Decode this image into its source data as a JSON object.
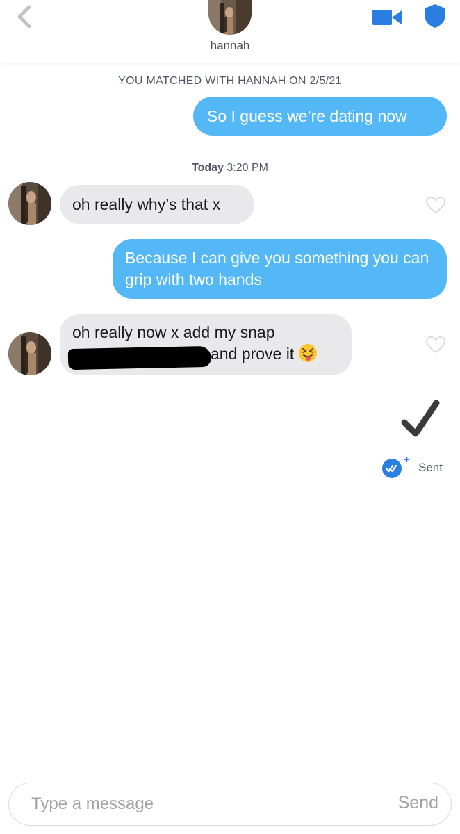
{
  "header": {
    "contact_name": "hannah"
  },
  "thread": {
    "match_banner": "YOU MATCHED WITH HANNAH ON 2/5/21",
    "timestamp_day": "Today",
    "timestamp_time": "3:20 PM",
    "messages": [
      {
        "direction": "outgoing",
        "text": "So I guess we’re dating now"
      },
      {
        "direction": "incoming",
        "text": "oh really why’s that x"
      },
      {
        "direction": "outgoing",
        "text": "Because I can give you something you can grip with two hands"
      },
      {
        "direction": "incoming",
        "line1": "oh really now x add my snap",
        "line2_visible": "and prove it",
        "emoji": "tongue-out-squint-emoji",
        "redacted": true
      }
    ],
    "status": {
      "sent_label": "Sent",
      "read_receipt_badge": "+"
    }
  },
  "composer": {
    "placeholder": "Type a message",
    "send_label": "Send"
  },
  "colors": {
    "outgoing_bubble": "#53b8f5",
    "incoming_bubble": "#e9e9eb",
    "accent_blue": "#2a7de1",
    "muted_text": "#505965",
    "placeholder_text": "#a3a3a3"
  }
}
